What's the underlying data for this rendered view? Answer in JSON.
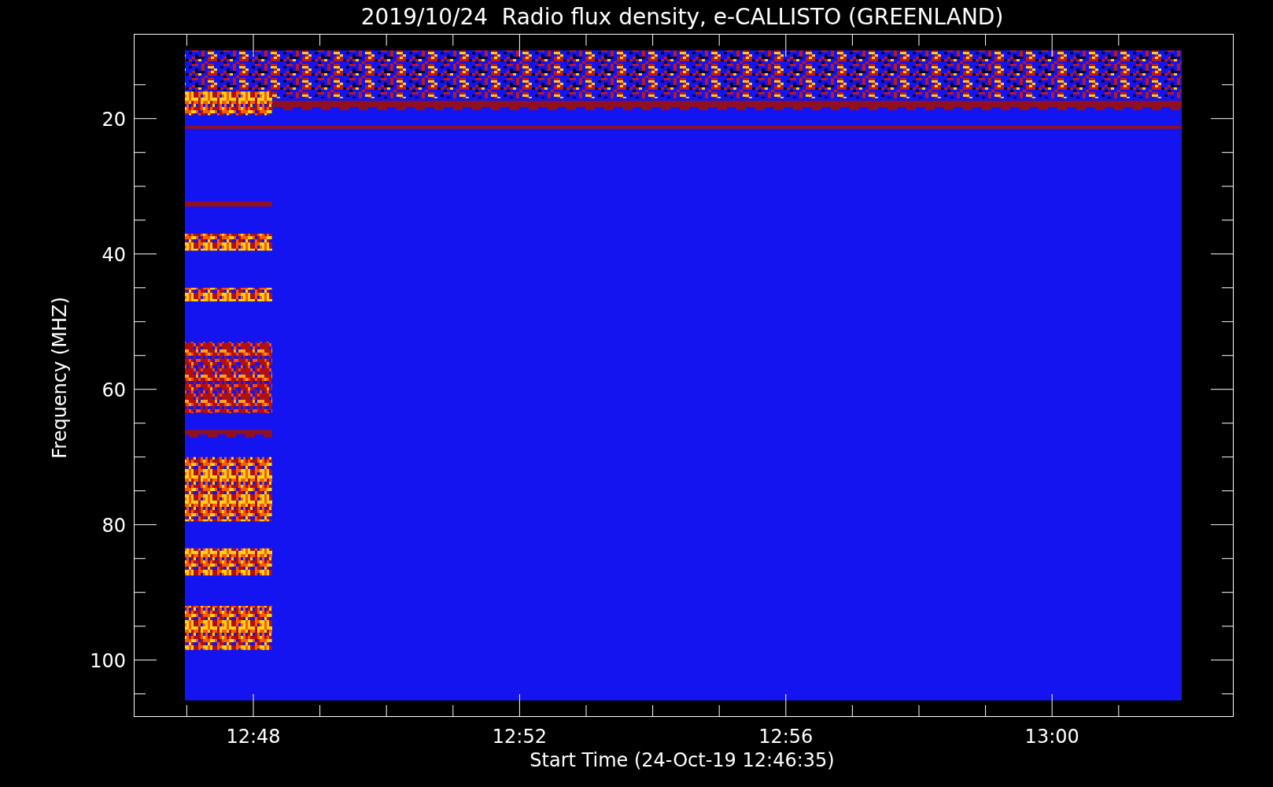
{
  "title": "2019/10/24  Radio flux density, e-CALLISTO (GREENLAND)",
  "y_axis": {
    "label": "Frequency (MHZ)",
    "ticks": [
      "20",
      "40",
      "60",
      "80",
      "100"
    ]
  },
  "x_axis": {
    "label": "Start Time (24-Oct-19 12:46:35)",
    "ticks": [
      "12:48",
      "12:52",
      "12:56",
      "13:00"
    ]
  }
}
